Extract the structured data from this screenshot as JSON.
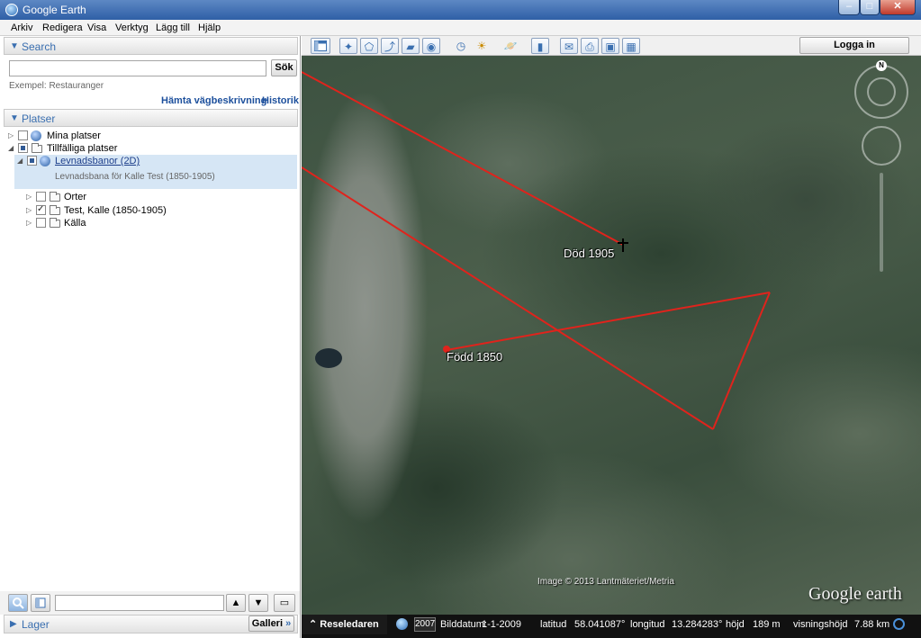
{
  "window": {
    "title": "Google Earth",
    "minimize": "–",
    "maximize": "□",
    "close": "✕"
  },
  "menu": [
    "Arkiv",
    "Redigera",
    "Visa",
    "Verktyg",
    "Lägg till",
    "Hjälp"
  ],
  "search": {
    "header": "Search",
    "input_value": "",
    "button": "Sök",
    "hint": "Exempel: Restauranger",
    "directions_link": "Hämta vägbeskrivning",
    "history_link": "Historik"
  },
  "places": {
    "header": "Platser",
    "items": [
      {
        "label": "Mina platser",
        "checked": false
      },
      {
        "label": "Tillfälliga platser",
        "checked": "partial"
      },
      {
        "label": "Levnadsbanor (2D)",
        "checked": "partial",
        "description": "Levnadsbana för Kalle Test (1850-1905)"
      },
      {
        "label": "Orter",
        "checked": false
      },
      {
        "label": "Test, Kalle (1850-1905)",
        "checked": true
      },
      {
        "label": "Källa",
        "checked": false
      }
    ]
  },
  "layers": {
    "header": "Lager",
    "gallery_button": "Galleri",
    "gallery_chevron": "»"
  },
  "toolbar": {
    "login_button": "Logga in"
  },
  "map": {
    "labels": {
      "death": "Död 1905",
      "birth": "Född 1850"
    },
    "compass_north": "N",
    "copyright": "Image © 2013 Lantmäteriet/Metria",
    "logo": "Google earth"
  },
  "status": {
    "tour_guide": "Reseledaren",
    "year": "2007",
    "image_date_label": "Bilddatum:",
    "image_date": "1-1-2009",
    "lat_label": "latitud",
    "lat": "58.041087°",
    "lon_label": "longitud",
    "lon": "13.284283°",
    "elev_label": "höjd",
    "elev": "189 m",
    "eye_label": "visningshöjd",
    "eye": "7.88 km"
  }
}
